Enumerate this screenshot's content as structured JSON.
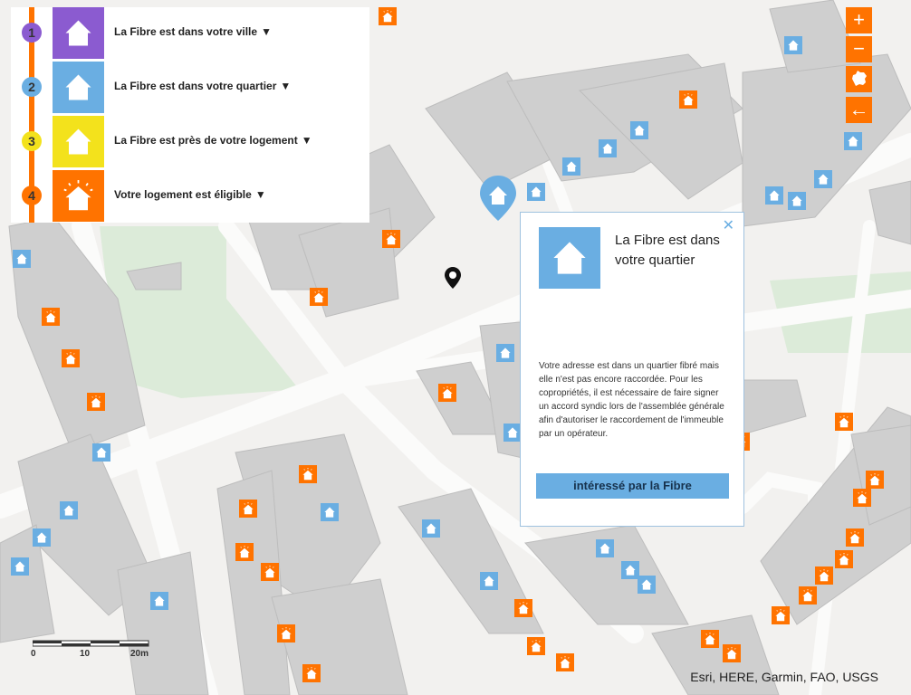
{
  "legend": {
    "items": [
      {
        "num": "1",
        "label": "La Fibre est dans votre ville",
        "color": "#8b5bd0",
        "num_color": "#8b5bd0"
      },
      {
        "num": "2",
        "label": "La Fibre est dans votre quartier",
        "color": "#6aaee2",
        "num_color": "#6aaee2"
      },
      {
        "num": "3",
        "label": "La Fibre est près de votre logement",
        "color": "#f3e21c",
        "num_color": "#f3e21c"
      },
      {
        "num": "4",
        "label": "Votre logement est éligible",
        "color": "#ff7300",
        "num_color": "#ff7300"
      }
    ],
    "arrow": "▼"
  },
  "controls": {
    "zoom_in": "+",
    "zoom_out": "−",
    "back": "←"
  },
  "popup": {
    "close": "✕",
    "title": "La Fibre est dans votre quartier",
    "body": "Votre adresse est dans un quartier fibré mais elle n'est pas encore raccordée. Pour les copropriétés, il est nécessaire de faire signer un accord syndic lors de l'assemblée générale afin d'autoriser le raccordement de l'immeuble par un opérateur.",
    "button": "intéressé par la Fibre"
  },
  "scale": {
    "labels": [
      "0",
      "10",
      "20m"
    ]
  },
  "attribution": "Esri, HERE, Garmin, FAO, USGS",
  "colors": {
    "blue": "#6aaee2",
    "orange": "#ff7300",
    "purple": "#8b5bd0",
    "yellow": "#f3e21c"
  }
}
